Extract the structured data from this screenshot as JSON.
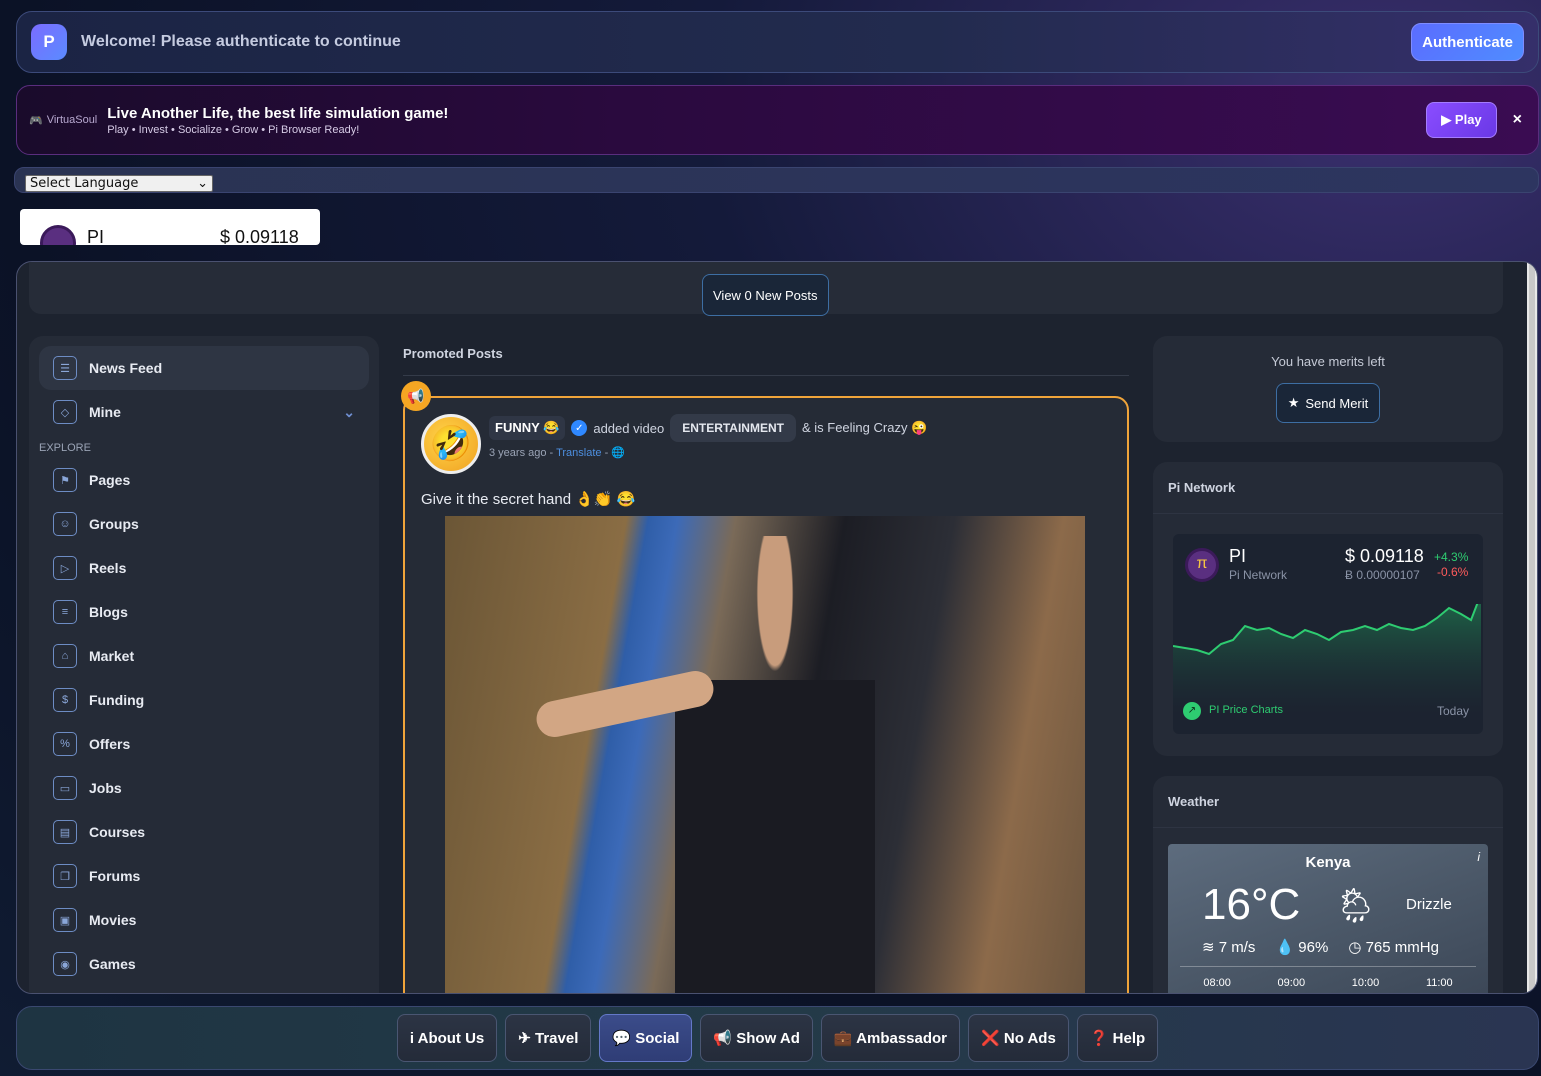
{
  "auth": {
    "logo_letter": "P",
    "message": "Welcome! Please authenticate to continue",
    "button_label": "Authenticate"
  },
  "ad": {
    "brand": "VirtuaSoul",
    "title": "Live Another Life, the best life simulation game!",
    "subtitle": "Play • Invest • Socialize • Grow • Pi Browser Ready!",
    "play_label": "▶ Play",
    "close_label": "×"
  },
  "language": {
    "selected": "Select Language"
  },
  "ticker": {
    "name": "PI",
    "price": "$ 0.09118"
  },
  "feed": {
    "view_new_label": "View 0 New Posts",
    "section_title": "Promoted Posts",
    "post": {
      "author": "FUNNY 😂",
      "action": "added video",
      "category": "ENTERTAINMENT",
      "feeling": "& is Feeling Crazy 😜",
      "time": "3 years ago",
      "translate": "Translate",
      "text": "Give it the secret hand 👌👏 😂"
    }
  },
  "sidebar": {
    "explore_label": "EXPLORE",
    "top_items": [
      {
        "label": "News Feed",
        "icon": "news-feed-icon"
      },
      {
        "label": "Mine",
        "icon": "cube-icon"
      }
    ],
    "items": [
      {
        "label": "Pages",
        "icon": "flag-icon"
      },
      {
        "label": "Groups",
        "icon": "groups-icon"
      },
      {
        "label": "Reels",
        "icon": "reels-icon"
      },
      {
        "label": "Blogs",
        "icon": "blog-icon"
      },
      {
        "label": "Market",
        "icon": "market-icon"
      },
      {
        "label": "Funding",
        "icon": "money-bag-icon"
      },
      {
        "label": "Offers",
        "icon": "offer-icon"
      },
      {
        "label": "Jobs",
        "icon": "briefcase-icon"
      },
      {
        "label": "Courses",
        "icon": "courses-icon"
      },
      {
        "label": "Forums",
        "icon": "forum-icon"
      },
      {
        "label": "Movies",
        "icon": "movies-icon"
      },
      {
        "label": "Games",
        "icon": "gamepad-icon"
      }
    ]
  },
  "merit": {
    "text": "You have merits left",
    "button_label": "Send Merit"
  },
  "pi_network": {
    "title": "Pi Network",
    "coin": "PI",
    "coin_name": "Pi Network",
    "price": "$ 0.09118",
    "btc_price": "Ƀ 0.00000107",
    "change_up": "+4.3%",
    "change_down": "-0.6%",
    "charts_label": "PI Price Charts",
    "period_label": "Today"
  },
  "weather": {
    "title": "Weather",
    "city": "Kenya",
    "temp": "16°C",
    "condition": "Drizzle",
    "wind": "7 m/s",
    "humidity": "96%",
    "pressure": "765 mmHg",
    "hours": [
      "08:00",
      "09:00",
      "10:00",
      "11:00"
    ]
  },
  "bottom_bar": [
    {
      "label": "i About Us"
    },
    {
      "label": "✈ Travel"
    },
    {
      "label": "💬 Social"
    },
    {
      "label": "📢 Show Ad"
    },
    {
      "label": "💼 Ambassador"
    },
    {
      "label": "❌ No Ads"
    },
    {
      "label": "❓ Help"
    }
  ]
}
